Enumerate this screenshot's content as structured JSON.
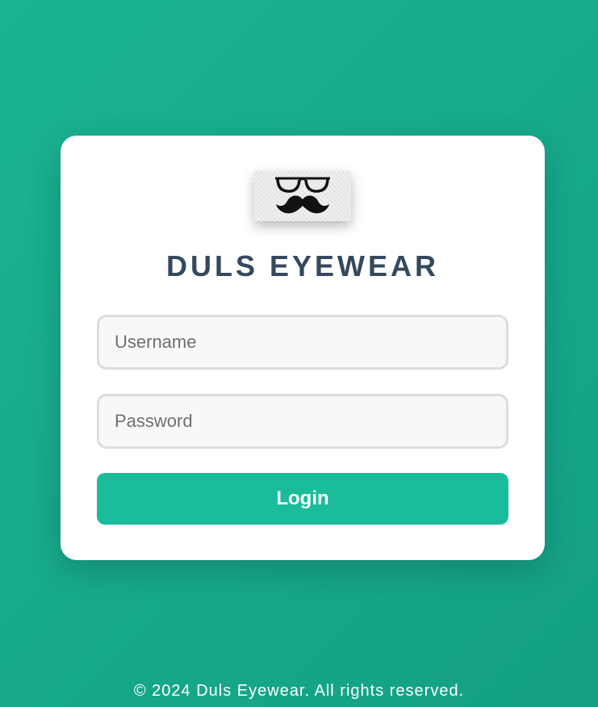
{
  "logo": {
    "icon": "glasses-mustache-icon"
  },
  "brand": {
    "title": "DULS EYEWEAR"
  },
  "form": {
    "username_placeholder": "Username",
    "username_value": "",
    "password_placeholder": "Password",
    "password_value": "",
    "login_label": "Login"
  },
  "footer": {
    "text": "© 2024 Duls Eyewear. All rights reserved."
  },
  "colors": {
    "background": "#1bb394",
    "accent": "#1abc9c",
    "title": "#34495e",
    "card": "#ffffff"
  }
}
